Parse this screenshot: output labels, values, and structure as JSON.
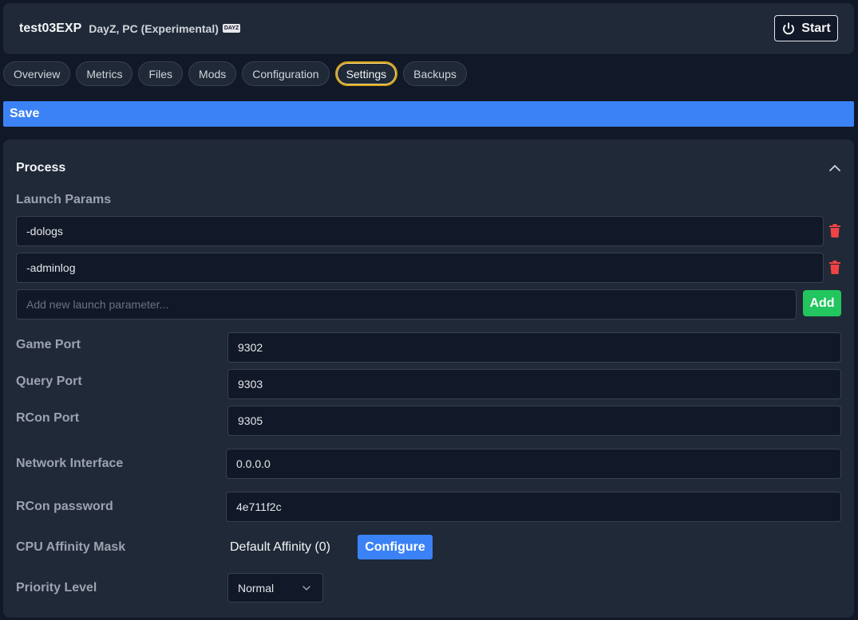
{
  "header": {
    "server_name": "test03EXP",
    "game": "DayZ, PC (Experimental)",
    "game_badge": "DAYZ",
    "start_label": "Start"
  },
  "tabs": [
    {
      "label": "Overview",
      "active": false
    },
    {
      "label": "Metrics",
      "active": false
    },
    {
      "label": "Files",
      "active": false
    },
    {
      "label": "Mods",
      "active": false
    },
    {
      "label": "Configuration",
      "active": false
    },
    {
      "label": "Settings",
      "active": true
    },
    {
      "label": "Backups",
      "active": false
    }
  ],
  "save_label": "Save",
  "process": {
    "title": "Process",
    "launch_params_label": "Launch Params",
    "launch_params": [
      "-dologs",
      "-adminlog"
    ],
    "new_param_placeholder": "Add new launch parameter...",
    "add_label": "Add",
    "game_port_label": "Game Port",
    "game_port": "9302",
    "query_port_label": "Query Port",
    "query_port": "9303",
    "rcon_port_label": "RCon Port",
    "rcon_port": "9305",
    "network_interface_label": "Network Interface",
    "network_interface": "0.0.0.0",
    "rcon_password_label": "RCon password",
    "rcon_password": "4e711f2c",
    "cpu_affinity_label": "CPU Affinity Mask",
    "cpu_affinity_value": "Default Affinity (0)",
    "configure_label": "Configure",
    "priority_label": "Priority Level",
    "priority_value": "Normal"
  },
  "colors": {
    "accent_blue": "#3b82f6",
    "add_green": "#22c55e",
    "delete_red": "#ef4444",
    "active_tab_border": "#d4a017"
  }
}
